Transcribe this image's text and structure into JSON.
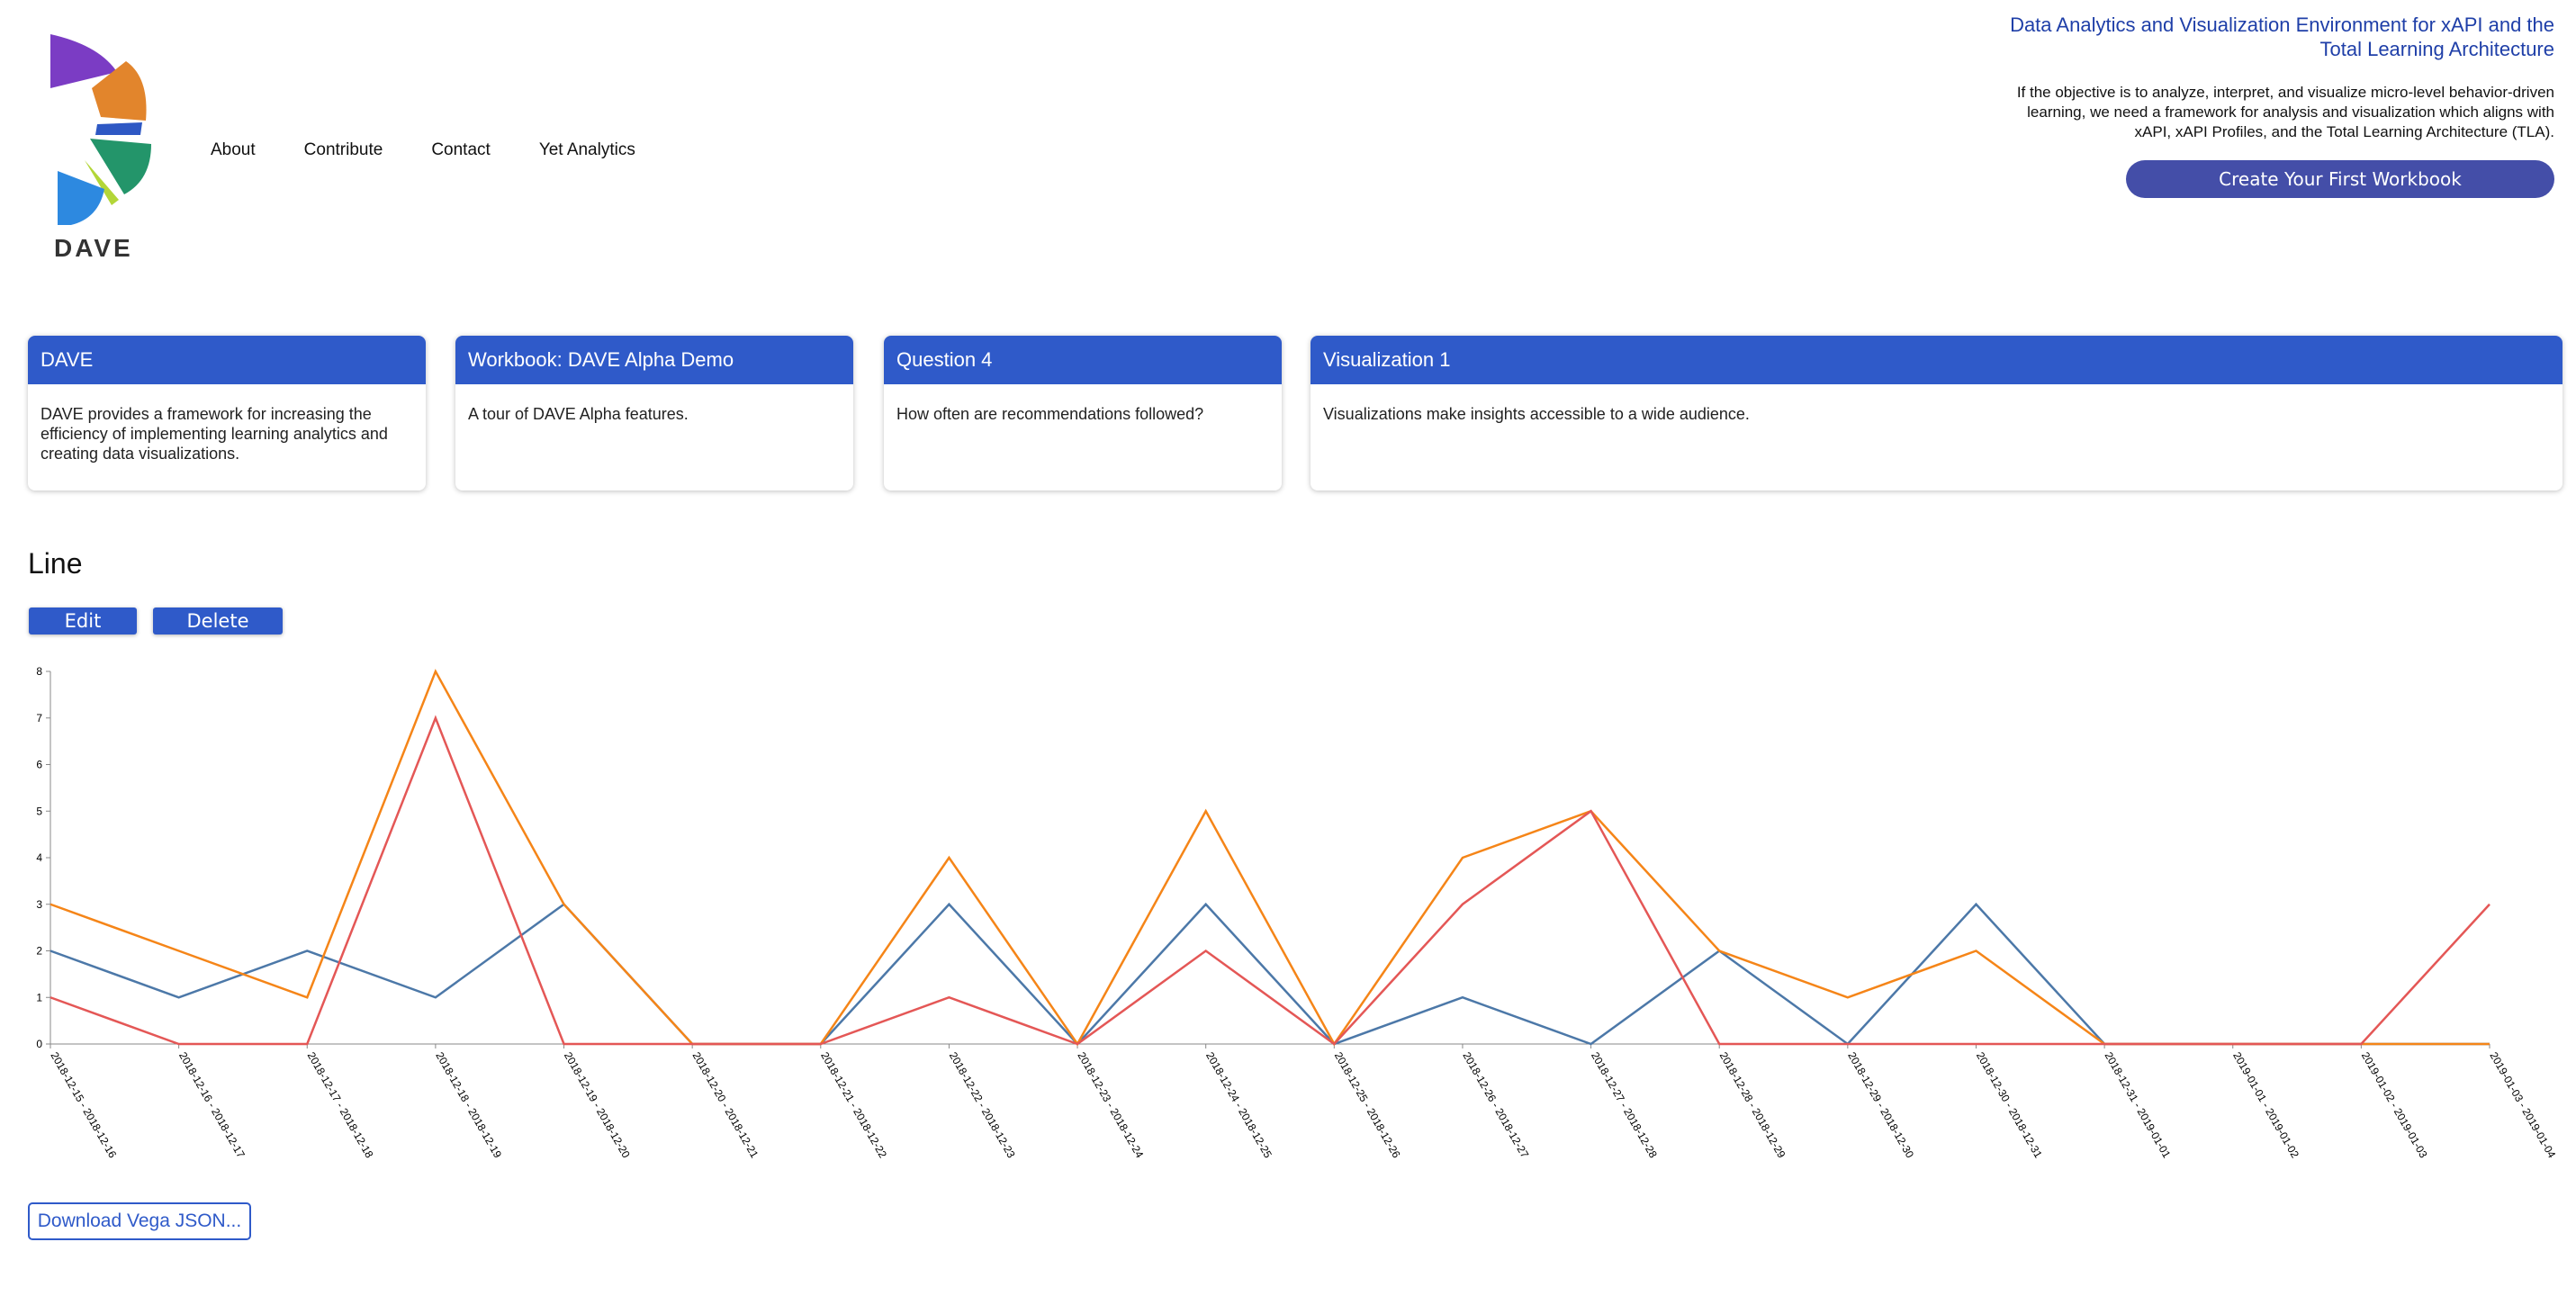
{
  "brand": {
    "name": "DAVE"
  },
  "nav": {
    "items": [
      {
        "label": "About"
      },
      {
        "label": "Contribute"
      },
      {
        "label": "Contact"
      },
      {
        "label": "Yet Analytics"
      }
    ]
  },
  "hero": {
    "title": "Data Analytics and Visualization Environment for xAPI and the Total Learning Architecture",
    "description": "If the objective is to analyze, interpret, and visualize micro-level behavior-driven learning, we need a framework for analysis and visualization which aligns with xAPI, xAPI Profiles, and the Total Learning Architecture (TLA).",
    "cta_label": "Create Your First Workbook"
  },
  "cards": [
    {
      "title": "DAVE",
      "body": "DAVE provides a framework for increasing the efficiency of implementing learning analytics and creating data visualizations."
    },
    {
      "title": "Workbook: DAVE Alpha Demo",
      "body": "A tour of DAVE Alpha features."
    },
    {
      "title": "Question 4",
      "body": "How often are recommendations followed?"
    },
    {
      "title": "Visualization 1",
      "body": "Visualizations make insights accessible to a wide audience."
    }
  ],
  "section": {
    "title": "Line",
    "edit_label": "Edit",
    "delete_label": "Delete"
  },
  "download_label": "Download Vega JSON...",
  "chart_data": {
    "type": "line",
    "categories": [
      "2018-12-15 - 2018-12-16",
      "2018-12-16 - 2018-12-17",
      "2018-12-17 - 2018-12-18",
      "2018-12-18 - 2018-12-19",
      "2018-12-19 - 2018-12-20",
      "2018-12-20 - 2018-12-21",
      "2018-12-21 - 2018-12-22",
      "2018-12-22 - 2018-12-23",
      "2018-12-23 - 2018-12-24",
      "2018-12-24 - 2018-12-25",
      "2018-12-25 - 2018-12-26",
      "2018-12-26 - 2018-12-27",
      "2018-12-27 - 2018-12-28",
      "2018-12-28 - 2018-12-29",
      "2018-12-29 - 2018-12-30",
      "2018-12-30 - 2018-12-31",
      "2018-12-31 - 2019-01-01",
      "2019-01-01 - 2019-01-02",
      "2019-01-02 - 2019-01-03",
      "2019-01-03 - 2019-01-04"
    ],
    "series": [
      {
        "color": "#4c78a8",
        "values": [
          2,
          1,
          2,
          1,
          3,
          0,
          0,
          3,
          0,
          3,
          0,
          1,
          0,
          2,
          0,
          3,
          0,
          0,
          0,
          0
        ]
      },
      {
        "color": "#f58518",
        "values": [
          3,
          2,
          1,
          8,
          3,
          0,
          0,
          4,
          0,
          5,
          0,
          4,
          5,
          2,
          1,
          2,
          0,
          0,
          0,
          0
        ]
      },
      {
        "color": "#e45756",
        "values": [
          1,
          0,
          0,
          7,
          0,
          0,
          0,
          1,
          0,
          2,
          0,
          3,
          5,
          0,
          0,
          0,
          0,
          0,
          0,
          3
        ]
      }
    ],
    "ylim": [
      0,
      8
    ],
    "yticks": [
      0,
      1,
      2,
      3,
      4,
      5,
      6,
      7,
      8
    ],
    "grid": false,
    "legend": "none"
  }
}
